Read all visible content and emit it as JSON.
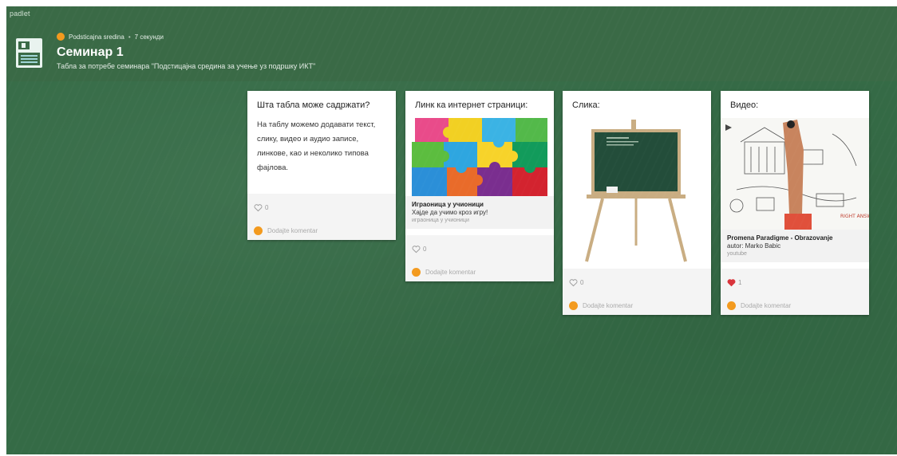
{
  "app": {
    "brand": "padlet"
  },
  "board": {
    "author": "Podsticajna sredina",
    "separator": "•",
    "time": "7 секунди",
    "title": "Семинар 1",
    "subtitle": "Табла за потребе семинара \"Подстицајна средина за учење уз подршку ИКТ\"",
    "background_color": "#356b46",
    "avatar_color": "#f39a1e"
  },
  "posts": [
    {
      "title": "Шта табла може садржати?",
      "body": "На таблу можемо додавати текст, слику, видео и аудио записе, линкове, као и неколико типова фајлова.",
      "likes": "0",
      "liked": false,
      "comment_placeholder": "Dodajte komentar"
    },
    {
      "title": "Линк ка интернет страници:",
      "image": "puzzle-image",
      "link_title": "Играоница у учионици",
      "link_description": "Хајде да учимо кроз игру!",
      "link_source": "играоница у учионици",
      "likes": "0",
      "liked": false,
      "comment_placeholder": "Dodajte komentar"
    },
    {
      "title": "Слика:",
      "image": "chalkboard-easel-image",
      "likes": "0",
      "liked": false,
      "comment_placeholder": "Dodajte komentar"
    },
    {
      "title": "Видео:",
      "image": "video-thumbnail",
      "video_title": "Promena Paradigme - Obrazovanje",
      "video_author": "autor: Marko Babic",
      "video_source": "youtube",
      "likes": "1",
      "liked": true,
      "heart_color": "#d9343b",
      "comment_placeholder": "Dodajte komentar"
    }
  ]
}
